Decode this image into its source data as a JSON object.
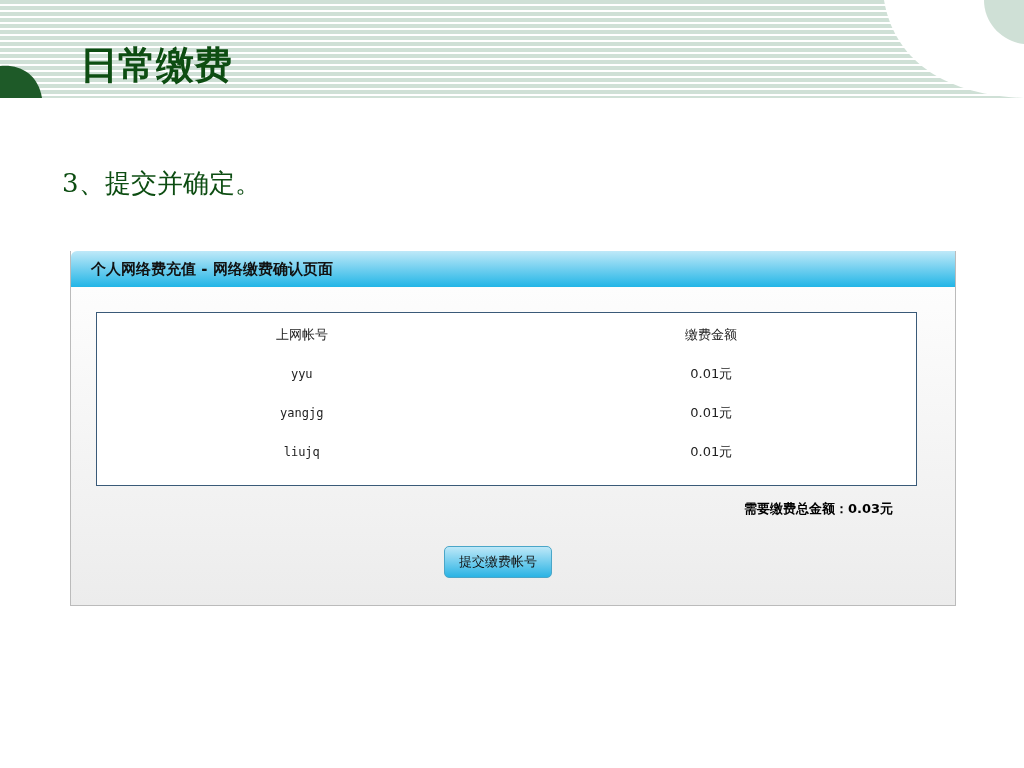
{
  "slide": {
    "title": "日常缴费",
    "step": "3、提交并确定。"
  },
  "panel": {
    "title": "个人网络费充值 - 网络缴费确认页面",
    "columns": [
      "上网帐号",
      "缴费金额"
    ],
    "rows": [
      {
        "account": "yyu",
        "amount": "0.01元"
      },
      {
        "account": "yangjg",
        "amount": "0.01元"
      },
      {
        "account": "liujq",
        "amount": "0.01元"
      }
    ],
    "total": "需要缴费总金额：0.03元",
    "button": "提交缴费帐号"
  }
}
